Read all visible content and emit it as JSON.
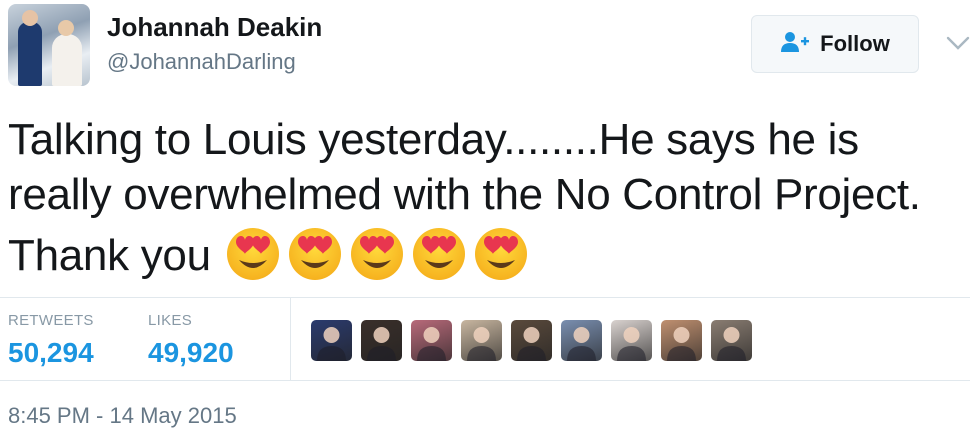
{
  "user": {
    "display_name": "Johannah Deakin",
    "handle": "@JohannahDarling"
  },
  "follow_button": {
    "label": "Follow"
  },
  "tweet": {
    "text": "Talking to Louis yesterday........He says he is really overwhelmed with the No Control Project. Thank you",
    "emoji": [
      "smiling-face-with-heart-eyes",
      "smiling-face-with-heart-eyes",
      "smiling-face-with-heart-eyes",
      "smiling-face-with-heart-eyes",
      "smiling-face-with-heart-eyes"
    ]
  },
  "stats": {
    "retweets_label": "RETWEETS",
    "retweets_value": "50,294",
    "likes_label": "LIKES",
    "likes_value": "49,920"
  },
  "likers": [
    {
      "icon": "liker-avatar",
      "bg": "#2b3b6e"
    },
    {
      "icon": "liker-avatar",
      "bg": "#3a2f2a"
    },
    {
      "icon": "liker-avatar",
      "bg": "#b86a7a"
    },
    {
      "icon": "liker-avatar",
      "bg": "#c8b6a0"
    },
    {
      "icon": "liker-avatar",
      "bg": "#5a4a3c"
    },
    {
      "icon": "liker-avatar",
      "bg": "#7a8fb0"
    },
    {
      "icon": "liker-avatar",
      "bg": "#d9d2cf"
    },
    {
      "icon": "liker-avatar",
      "bg": "#c09070"
    },
    {
      "icon": "liker-avatar",
      "bg": "#8a7d72"
    }
  ],
  "timestamp": "8:45 PM - 14 May 2015",
  "colors": {
    "link_blue": "#1b95e0",
    "muted": "#657786",
    "border": "#e1e8ed"
  }
}
